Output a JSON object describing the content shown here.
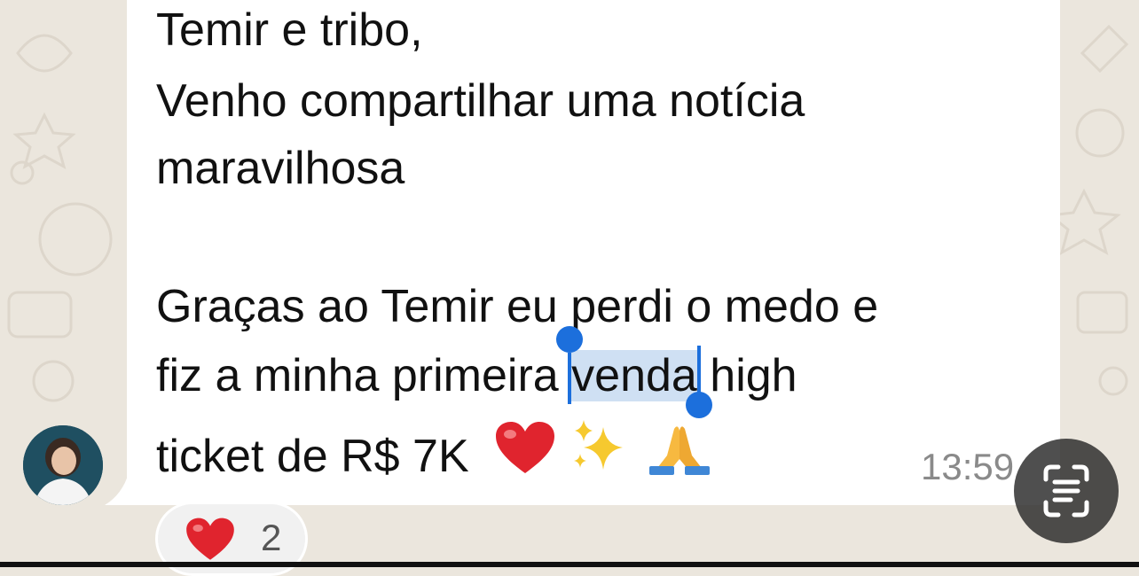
{
  "message": {
    "lines": {
      "l1": "Temir e tribo,",
      "l2": "Venho compartilhar uma notícia",
      "l3": "maravilhosa",
      "l4": "Graças ao Temir eu perdi o medo e",
      "l5_before": "fiz a minha primeira ",
      "l5_selected": "venda",
      "l5_after": " high",
      "l6": "ticket de R$ 7K"
    },
    "timestamp": "13:59"
  },
  "reaction": {
    "emoji": "heart-icon",
    "count": "2"
  },
  "icons": [
    "heart-icon",
    "sparkles-icon",
    "folded-hands-icon",
    "live-text-scan-icon"
  ],
  "colors": {
    "selection_handle": "#1c6fdc",
    "selection_highlight": "#cfe0f3",
    "bubble": "#ffffff",
    "wallpaper": "#ebe6dd"
  }
}
